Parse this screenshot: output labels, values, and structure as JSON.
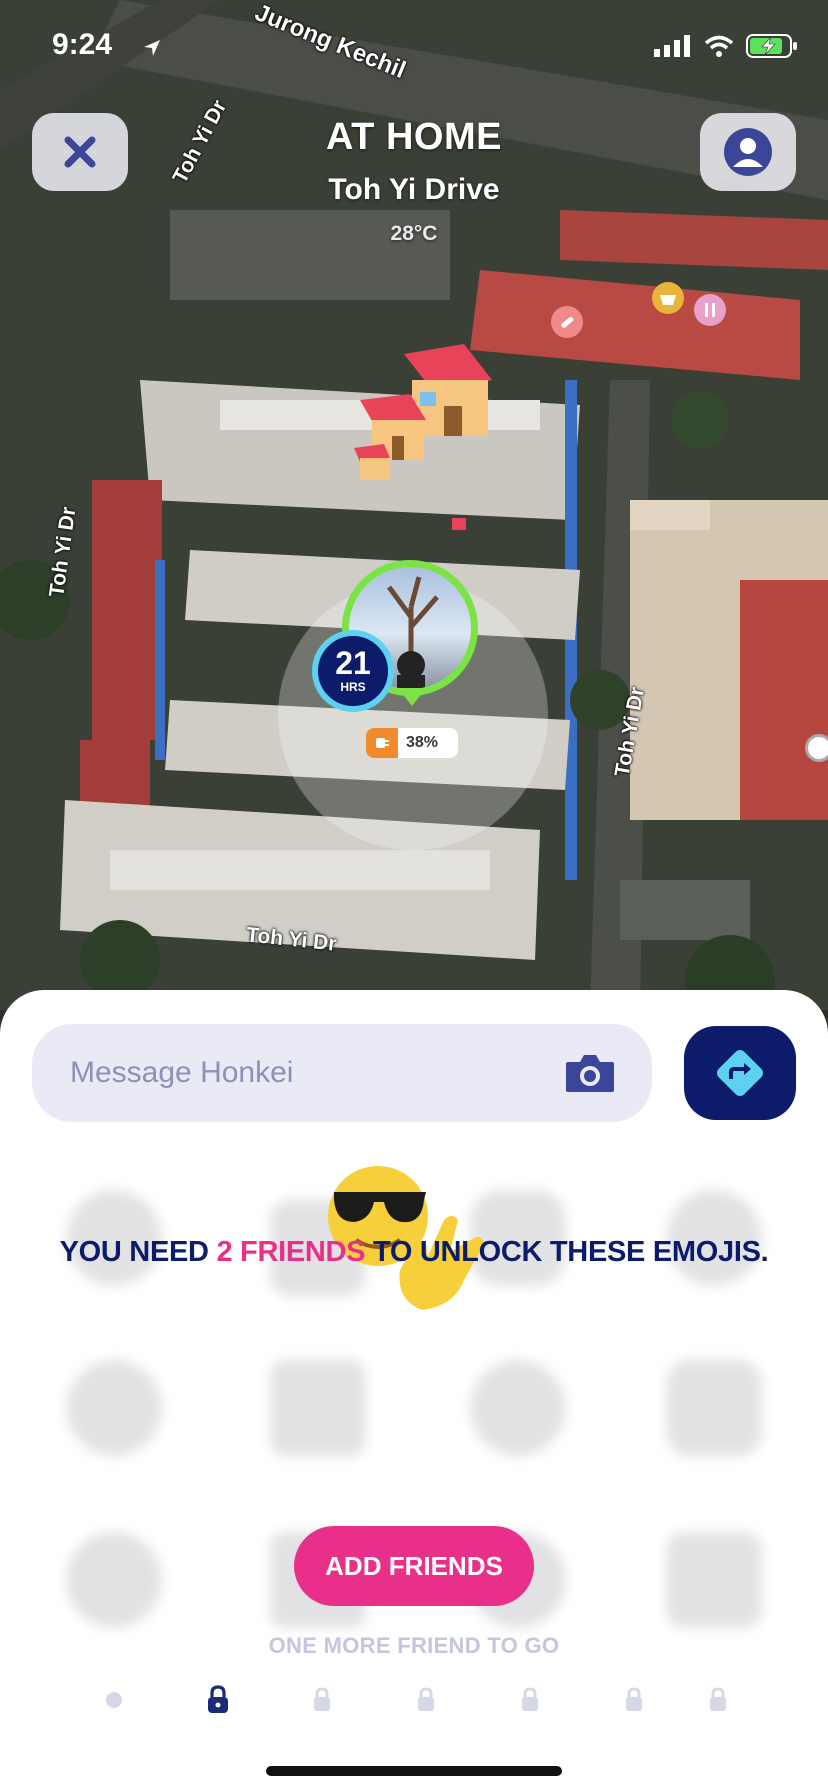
{
  "status_bar": {
    "time": "9:24"
  },
  "place": {
    "status": "AT HOME",
    "street": "Toh Yi Drive",
    "temperature": "28°C"
  },
  "map": {
    "road_labels": [
      "Jurong Kechil",
      "Toh Yi Dr",
      "Toh Yi Dr",
      "Toh Yi Dr",
      "Toh Yi Dr"
    ]
  },
  "friend": {
    "hours_at_place": "21",
    "hours_unit": "HRS",
    "battery": "38%"
  },
  "message": {
    "placeholder": "Message Honkei"
  },
  "unlock": {
    "prefix": "YOU NEED ",
    "highlight": "2 FRIENDS",
    "suffix": " TO UNLOCK THESE EMOJIS."
  },
  "actions": {
    "add_friends": "ADD FRIENDS",
    "progress_note": "ONE MORE FRIEND TO GO"
  },
  "colors": {
    "navy": "#0d1b6b",
    "pink": "#e8308a",
    "green": "#7ce346",
    "cyan": "#5dd2f0"
  }
}
